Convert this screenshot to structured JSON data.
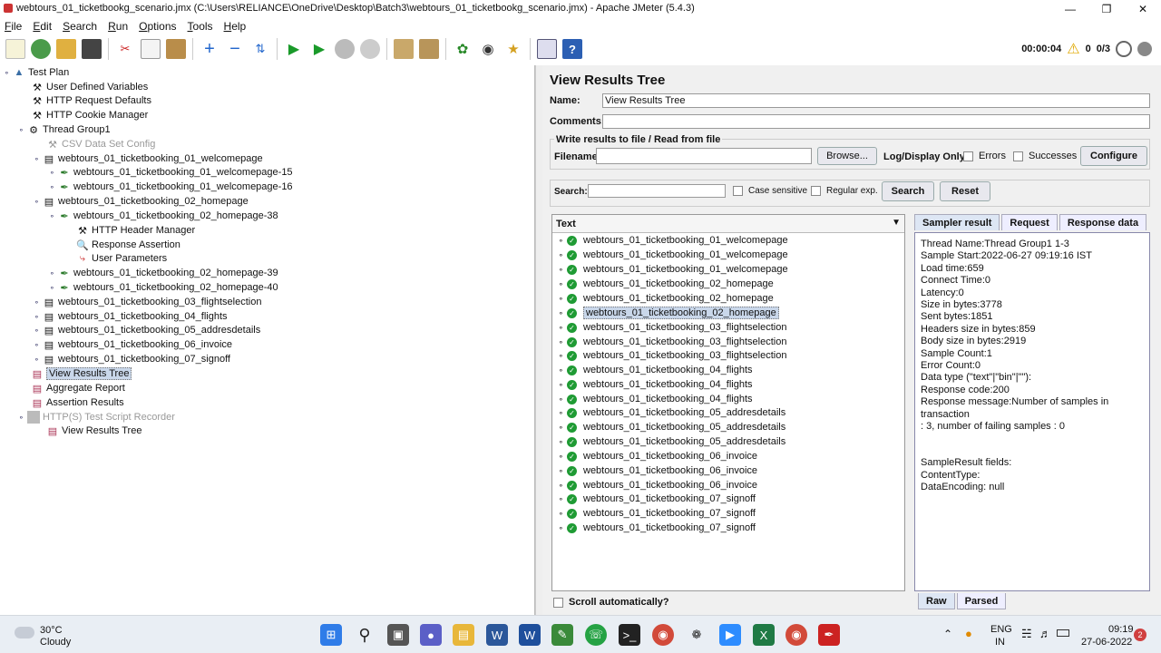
{
  "window": {
    "title": "webtours_01_ticketbookg_scenario.jmx (C:\\Users\\RELIANCE\\OneDrive\\Desktop\\Batch3\\webtours_01_ticketbookg_scenario.jmx) - Apache JMeter (5.4.3)"
  },
  "menu": [
    "File",
    "Edit",
    "Search",
    "Run",
    "Options",
    "Tools",
    "Help"
  ],
  "status": {
    "elapsed": "00:00:04",
    "warnings": "0",
    "threads": "0/3"
  },
  "tree": {
    "root": "Test Plan",
    "items": [
      "User Defined Variables",
      "HTTP Request Defaults",
      "HTTP Cookie Manager",
      "Thread Group1",
      "CSV Data Set Config",
      "webtours_01_ticketbooking_01_welcomepage",
      "webtours_01_ticketbooking_01_welcomepage-15",
      "webtours_01_ticketbooking_01_welcomepage-16",
      "webtours_01_ticketbooking_02_homepage",
      "webtours_01_ticketbooking_02_homepage-38",
      "HTTP Header Manager",
      "Response Assertion",
      "User Parameters",
      "webtours_01_ticketbooking_02_homepage-39",
      "webtours_01_ticketbooking_02_homepage-40",
      "webtours_01_ticketbooking_03_flightselection",
      "webtours_01_ticketbooking_04_flights",
      "webtours_01_ticketbooking_05_addresdetails",
      "webtours_01_ticketbooking_06_invoice",
      "webtours_01_ticketbooking_07_signoff",
      "View Results Tree",
      "Aggregate Report",
      "Assertion Results",
      "HTTP(S) Test Script Recorder",
      "View Results Tree"
    ]
  },
  "panel": {
    "title": "View Results Tree",
    "name_label": "Name:",
    "name_value": "View Results Tree",
    "comments_label": "Comments:",
    "write_group": "Write results to file / Read from file",
    "filename_label": "Filename",
    "browse": "Browse...",
    "log_display": "Log/Display Only:",
    "errors": "Errors",
    "successes": "Successes",
    "configure": "Configure",
    "search_label": "Search:",
    "case_sensitive": "Case sensitive",
    "regular_exp": "Regular exp.",
    "search_btn": "Search",
    "reset_btn": "Reset",
    "list_header": "Text",
    "scroll_auto": "Scroll automatically?"
  },
  "results": [
    "webtours_01_ticketbooking_01_welcomepage",
    "webtours_01_ticketbooking_01_welcomepage",
    "webtours_01_ticketbooking_01_welcomepage",
    "webtours_01_ticketbooking_02_homepage",
    "webtours_01_ticketbooking_02_homepage",
    "webtours_01_ticketbooking_02_homepage",
    "webtours_01_ticketbooking_03_flightselection",
    "webtours_01_ticketbooking_03_flightselection",
    "webtours_01_ticketbooking_03_flightselection",
    "webtours_01_ticketbooking_04_flights",
    "webtours_01_ticketbooking_04_flights",
    "webtours_01_ticketbooking_04_flights",
    "webtours_01_ticketbooking_05_addresdetails",
    "webtours_01_ticketbooking_05_addresdetails",
    "webtours_01_ticketbooking_05_addresdetails",
    "webtours_01_ticketbooking_06_invoice",
    "webtours_01_ticketbooking_06_invoice",
    "webtours_01_ticketbooking_06_invoice",
    "webtours_01_ticketbooking_07_signoff",
    "webtours_01_ticketbooking_07_signoff",
    "webtours_01_ticketbooking_07_signoff"
  ],
  "tabs": [
    "Sampler result",
    "Request",
    "Response data"
  ],
  "detail_lines": [
    "Thread Name:Thread Group1 1-3",
    "Sample Start:2022-06-27 09:19:16 IST",
    "Load time:659",
    "Connect Time:0",
    "Latency:0",
    "Size in bytes:3778",
    "Sent bytes:1851",
    "Headers size in bytes:859",
    "Body size in bytes:2919",
    "Sample Count:1",
    "Error Count:0",
    "Data type (\"text\"|\"bin\"|\"\"):",
    "Response code:200",
    "Response message:Number of samples in transaction",
    ": 3, number of failing samples : 0",
    "",
    "",
    "SampleResult fields:",
    "ContentType:",
    "DataEncoding: null"
  ],
  "bottom_tabs": [
    "Raw",
    "Parsed"
  ],
  "taskbar": {
    "weather_temp": "30°C",
    "weather_desc": "Cloudy",
    "lang1": "ENG",
    "lang2": "IN",
    "time": "09:19",
    "date": "27-06-2022",
    "notif_count": "2"
  }
}
